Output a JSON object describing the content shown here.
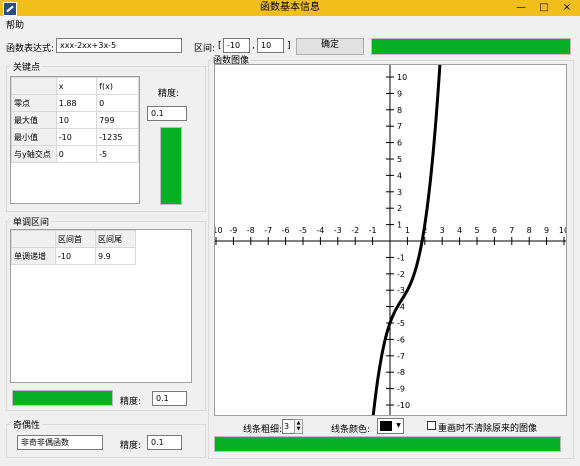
{
  "window": {
    "title": "函数基本信息",
    "min": "—",
    "max": "□",
    "close": "×"
  },
  "menu": {
    "help": "帮助"
  },
  "top": {
    "expr_label": "函数表达式:",
    "expr_value": "xxx-2xx+3x-5",
    "range_label": "区间:",
    "range_open": "[",
    "range_min": "-10",
    "range_sep": ",",
    "range_max": "10",
    "range_close": "]",
    "confirm_label": "确定",
    "progress": 1.0
  },
  "key_points": {
    "title": "关键点",
    "columns": [
      "",
      "x",
      "f(x)"
    ],
    "rows": [
      [
        "零点",
        "1.88",
        "0"
      ],
      [
        "最大值",
        "10",
        "799"
      ],
      [
        "最小值",
        "-10",
        "-1235"
      ],
      [
        "与y轴交点",
        "0",
        "-5"
      ]
    ],
    "precision_label": "精度:",
    "precision_value": "0.1",
    "progress": 1.0
  },
  "monotonic": {
    "title": "单调区间",
    "columns": [
      "",
      "区间首",
      "区间尾"
    ],
    "rows": [
      [
        "单调递增",
        "-10",
        "9.9"
      ]
    ],
    "precision_label": "精度:",
    "precision_value": "0.1",
    "progress": 1.0
  },
  "parity": {
    "title": "奇偶性",
    "value": "非奇非偶函数",
    "precision_label": "精度:",
    "precision_value": "0.1"
  },
  "graph": {
    "title": "函数图像",
    "line_width_label": "线条粗细:",
    "line_width_value": "3",
    "line_color_label": "线条颜色:",
    "line_color": "#000000",
    "redraw_label": "重画时不清除原来的图像",
    "redraw_checked": false,
    "progress": 1.0
  },
  "chart_data": {
    "type": "line",
    "function": "x^3-2x^2+3x-5",
    "xlim": [
      -10,
      10
    ],
    "ylim": [
      -10,
      10
    ],
    "x_ticks": [
      -10,
      -9,
      -8,
      -7,
      -6,
      -5,
      -4,
      -3,
      -2,
      -1,
      1,
      2,
      3,
      4,
      5,
      6,
      7,
      8,
      9,
      10
    ],
    "y_ticks": [
      10,
      9,
      8,
      7,
      6,
      5,
      4,
      3,
      2,
      1,
      -1,
      -2,
      -3,
      -4,
      -5,
      -6,
      -7,
      -8,
      -9,
      -10
    ],
    "series": [
      {
        "values_fn": "x*x*x-2*x*x+3*x-5"
      }
    ]
  }
}
